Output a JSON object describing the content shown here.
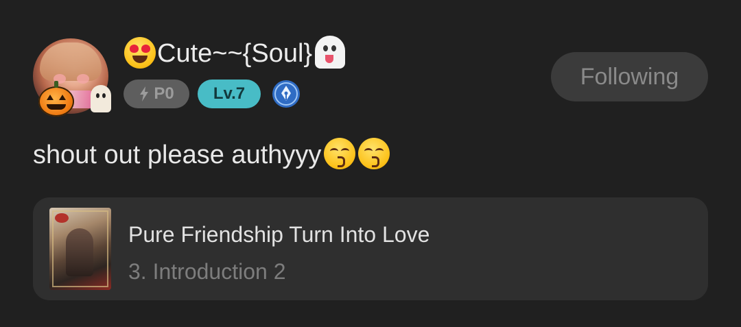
{
  "author": {
    "name": "Cute~~{Soul}",
    "name_prefix_emoji": "smiling-face-with-heart-eyes",
    "name_suffix_emoji": "ghost",
    "badges": {
      "power": "P0",
      "level": "Lv.7",
      "writer_icon": "pen-nib-icon"
    }
  },
  "follow_button": {
    "label": "Following"
  },
  "post": {
    "text": "shout out please authyyy",
    "trailing_emojis": [
      "kissing-face-with-closed-eyes",
      "kissing-face-with-closed-eyes"
    ]
  },
  "book": {
    "title": "Pure Friendship Turn Into Love",
    "chapter": "3. Introduction 2"
  },
  "colors": {
    "background": "#202020",
    "card": "#2f2f2f",
    "level_badge": "#48bcc6",
    "power_badge": "#5e5e5e",
    "follow_button": "#3b3b3b",
    "writer_badge": "#3a7fd8"
  }
}
